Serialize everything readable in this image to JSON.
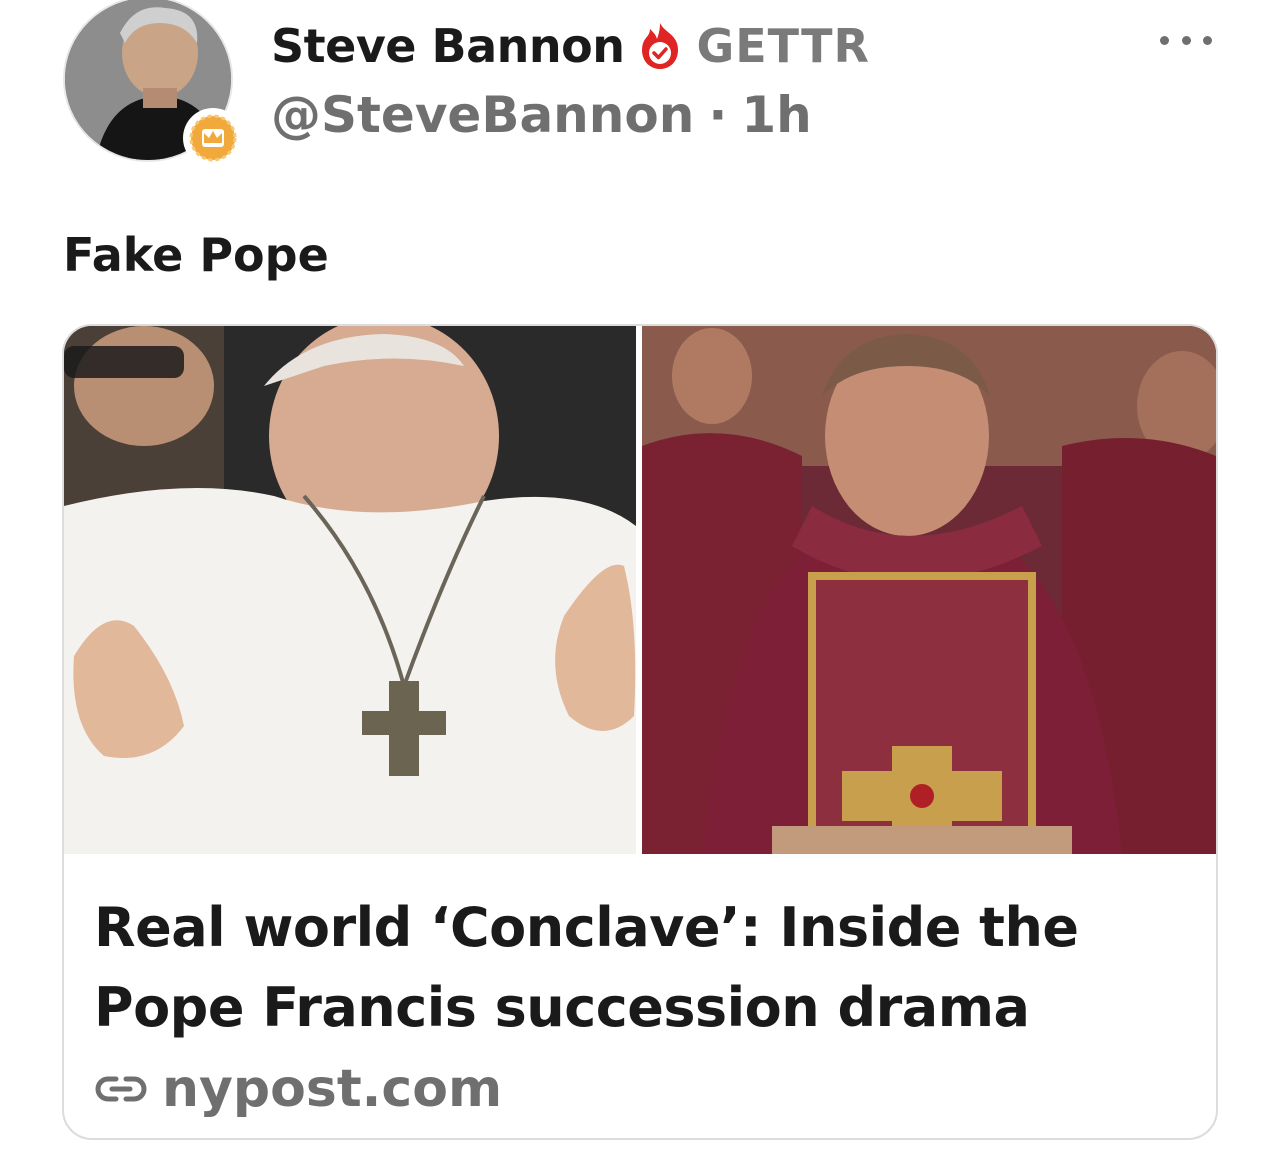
{
  "author": {
    "display_name": "Steve Bannon",
    "platform": "GETTR",
    "handle": "@SteveBannon",
    "separator": "·",
    "timestamp": "1h",
    "verified_icon": "verified-flame-check",
    "badge_icon": "crown-badge"
  },
  "post": {
    "text": "Fake Pope"
  },
  "link_card": {
    "title": "Real world ‘Conclave’: Inside the Pope Francis succession drama",
    "domain": "nypost.com",
    "link_icon": "link-icon"
  },
  "colors": {
    "verified_red": "#e02424",
    "crown_gold": "#f0a93a",
    "secondary_text": "#6f6f6f",
    "card_border": "#dcdcdc"
  }
}
